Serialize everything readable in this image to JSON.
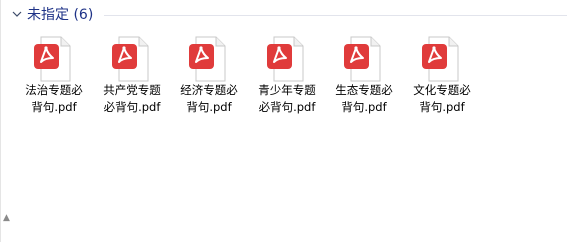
{
  "group": {
    "label": "未指定 (6)",
    "chevron_icon": "chevron-down-icon"
  },
  "colors": {
    "group_label": "#1e3287",
    "pdf_icon_red": "#e03b3b"
  },
  "files": [
    {
      "name_line1": "法治专题必",
      "name_line2": "背句.pdf",
      "icon": "pdf-file-icon"
    },
    {
      "name_line1": "共产党专题",
      "name_line2": "必背句.pdf",
      "icon": "pdf-file-icon"
    },
    {
      "name_line1": "经济专题必",
      "name_line2": "背句.pdf",
      "icon": "pdf-file-icon"
    },
    {
      "name_line1": "青少年专题",
      "name_line2": "必背句.pdf",
      "icon": "pdf-file-icon"
    },
    {
      "name_line1": "生态专题必",
      "name_line2": "背句.pdf",
      "icon": "pdf-file-icon"
    },
    {
      "name_line1": "文化专题必",
      "name_line2": "背句.pdf",
      "icon": "pdf-file-icon"
    }
  ]
}
